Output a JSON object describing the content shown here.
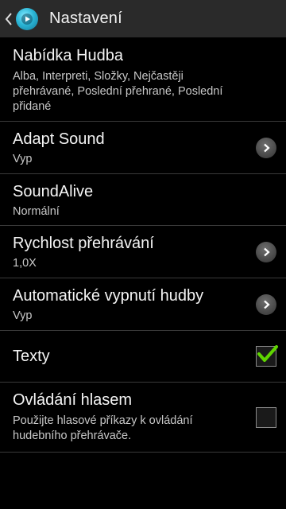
{
  "header": {
    "title": "Nastavení",
    "back_icon": "chevron-left-icon",
    "app_icon": "music-player-icon"
  },
  "settings": [
    {
      "title": "Nabídka Hudba",
      "summary": "Alba, Interpreti, Složky, Nejčastěji přehrávané, Poslední přehrané, Poslední přidané",
      "control": "none"
    },
    {
      "title": "Adapt Sound",
      "summary": "Vyp",
      "control": "chevron-right-icon"
    },
    {
      "title": "SoundAlive",
      "summary": "Normální",
      "control": "none"
    },
    {
      "title": "Rychlost přehrávání",
      "summary": "1,0X",
      "control": "chevron-right-icon"
    },
    {
      "title": "Automatické vypnutí hudby",
      "summary": "Vyp",
      "control": "chevron-right-icon"
    },
    {
      "title": "Texty",
      "control": "checkbox",
      "checked": true
    },
    {
      "title": "Ovládání hlasem",
      "summary": "Použijte hlasové příkazy k ovládání hudebního přehrávače.",
      "control": "checkbox",
      "checked": false
    }
  ],
  "colors": {
    "background": "#000000",
    "action_bar": "#2a2a2a",
    "divider": "#3a3a3a",
    "check_green": "#5fd400",
    "accent_cyan": "#2bb6d6"
  }
}
